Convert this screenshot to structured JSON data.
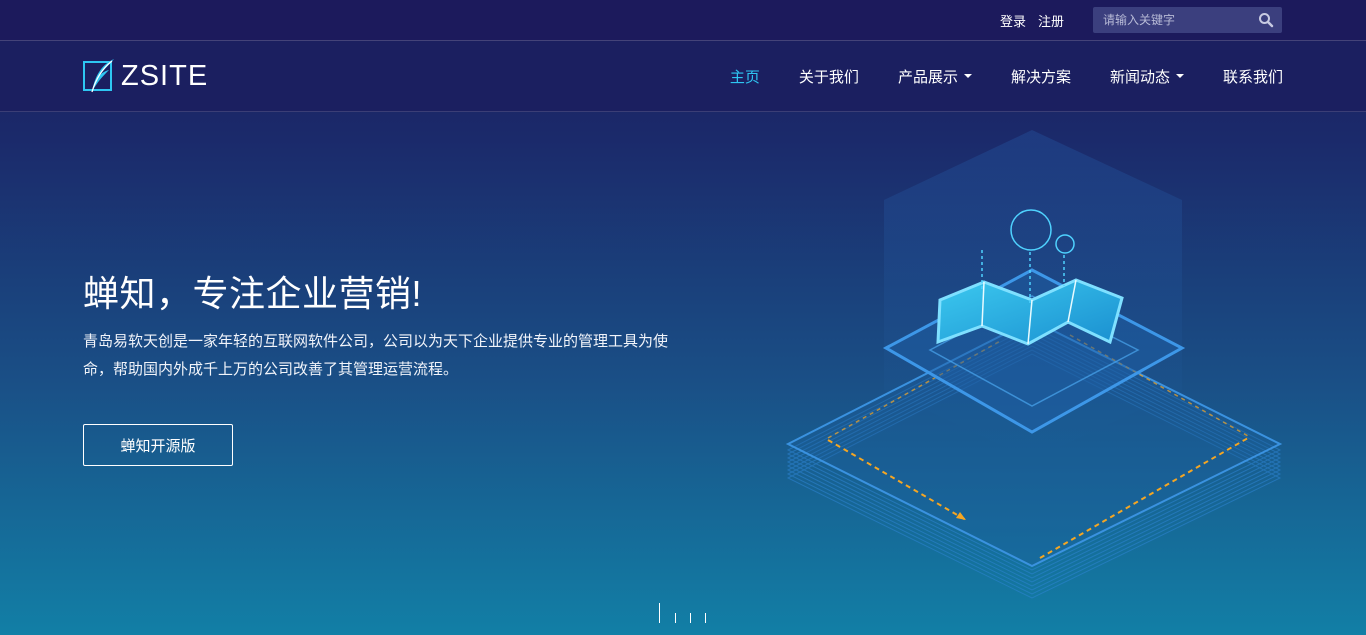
{
  "topbar": {
    "login": "登录",
    "register": "注册",
    "search_placeholder": "请输入关键字"
  },
  "logo": {
    "text": "ZSITE"
  },
  "nav": {
    "items": [
      {
        "label": "主页",
        "active": true,
        "dropdown": false
      },
      {
        "label": "关于我们",
        "active": false,
        "dropdown": false
      },
      {
        "label": "产品展示",
        "active": false,
        "dropdown": true
      },
      {
        "label": "解决方案",
        "active": false,
        "dropdown": false
      },
      {
        "label": "新闻动态",
        "active": false,
        "dropdown": true
      },
      {
        "label": "联系我们",
        "active": false,
        "dropdown": false
      }
    ]
  },
  "hero": {
    "title": "蝉知，专注企业营销!",
    "description": "青岛易软天创是一家年轻的互联网软件公司，公司以为天下企业提供专业的管理工具为使命，帮助国内外成千上万的公司改善了其管理运营流程。",
    "button": "蝉知开源版"
  },
  "carousel": {
    "slide_count": 4,
    "active_index": 0
  },
  "colors": {
    "accent": "#2ec6f2",
    "nav_bg": "#1b1f60",
    "topbar_bg": "#1c1a5c",
    "arrow": "#f5a623"
  },
  "icons": {
    "logo": "feather-logo-icon",
    "search": "search-icon",
    "dropdown": "caret-down-icon",
    "hero": "isometric-map-illustration"
  }
}
